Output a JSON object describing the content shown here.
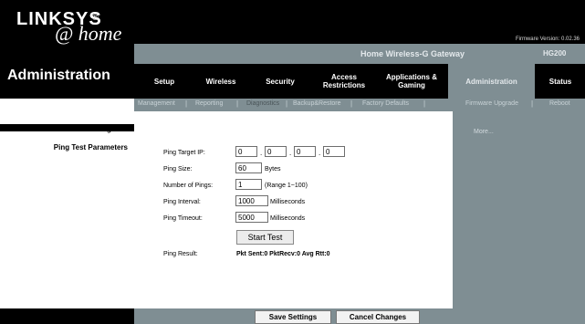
{
  "brand": {
    "logo": "LINKSYS",
    "logo_mark": "®",
    "sub": "@ home"
  },
  "firmware": "Firmware Version: 0.02.36",
  "product": {
    "name": "Home Wireless-G Gateway",
    "model": "HG200"
  },
  "page_title": "Administration",
  "tabs": [
    {
      "label": "Setup"
    },
    {
      "label": "Wireless"
    },
    {
      "label": "Security"
    },
    {
      "label": "Access Restrictions"
    },
    {
      "label": "Applications & Gaming"
    },
    {
      "label": "Administration"
    },
    {
      "label": "Status"
    }
  ],
  "subtabs": [
    {
      "label": "Management"
    },
    {
      "label": "Reporting"
    },
    {
      "label": "Diagnostics"
    },
    {
      "label": "Backup&Restore"
    },
    {
      "label": "Factory Defaults"
    },
    {
      "label": "Firmware Upgrade"
    },
    {
      "label": "Reboot"
    }
  ],
  "sidebar": {
    "title": "Ping Test",
    "subtitle": "Ping Test Parameters"
  },
  "form": {
    "target_label": "Ping Target IP:",
    "ip": [
      "0",
      "0",
      "0",
      "0"
    ],
    "size_label": "Ping Size:",
    "size_value": "60",
    "size_unit": "Bytes",
    "count_label": "Number of Pings:",
    "count_value": "1",
    "count_range": "(Range 1~100)",
    "interval_label": "Ping Interval:",
    "interval_value": "1000",
    "interval_unit": "Milliseconds",
    "timeout_label": "Ping Timeout:",
    "timeout_value": "5000",
    "timeout_unit": "Milliseconds",
    "start_button": "Start Test",
    "result_label": "Ping Result:",
    "result_value": "Pkt Sent:0 PktRecv:0 Avg Rtt:0"
  },
  "help": {
    "more": "More..."
  },
  "footer": {
    "save": "Save Settings",
    "cancel": "Cancel Changes"
  },
  "colors": {
    "header_bg": "#000000",
    "accent_gray": "#7f8e93"
  }
}
